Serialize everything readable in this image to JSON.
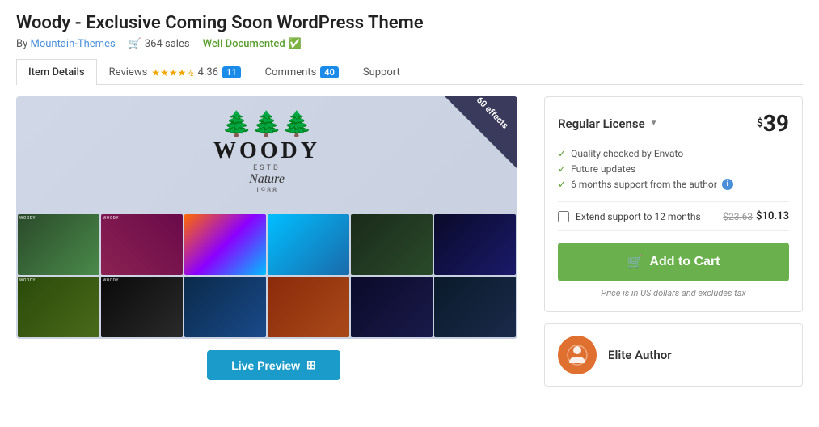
{
  "page": {
    "title": "Woody - Exclusive Coming Soon WordPress Theme"
  },
  "meta": {
    "by_label": "By",
    "author": "Mountain-Themes",
    "sales": "364 sales",
    "well_documented": "Well Documented"
  },
  "tabs": [
    {
      "id": "item-details",
      "label": "Item Details",
      "active": true
    },
    {
      "id": "reviews",
      "label": "Reviews",
      "active": false
    },
    {
      "id": "comments",
      "label": "Comments",
      "active": false
    },
    {
      "id": "support",
      "label": "Support",
      "active": false
    }
  ],
  "reviews": {
    "rating": "4.36",
    "count": "11"
  },
  "comments": {
    "count": "40"
  },
  "preview": {
    "badge_text": "60 effects",
    "woody_text": "WOODY",
    "estd": "ESTD",
    "nature": "Nature",
    "year": "1988",
    "divider": "—"
  },
  "live_preview": {
    "label": "Live Preview"
  },
  "license": {
    "title": "Regular License",
    "price_symbol": "$",
    "price": "39",
    "features": [
      "Quality checked by Envato",
      "Future updates",
      "6 months support from the author"
    ],
    "extend_label": "Extend support to 12 months",
    "extend_old_price": "$23.63",
    "extend_new_price": "$10.13",
    "add_to_cart_label": "Add to Cart",
    "price_note": "Price is in US dollars and excludes tax"
  },
  "elite_author": {
    "label": "Elite Author"
  },
  "icons": {
    "cart": "🛒",
    "check": "✓",
    "info": "i",
    "trees": "🌲🌲🌲",
    "grid": "⊞"
  }
}
